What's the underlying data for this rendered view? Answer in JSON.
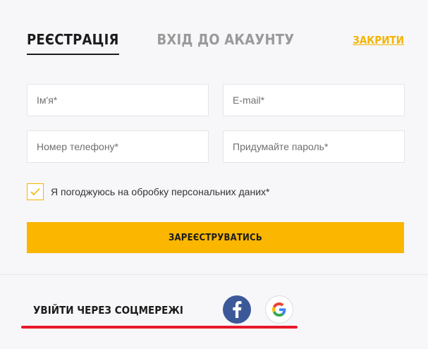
{
  "tabs": [
    {
      "label": "РЕЄСТРАЦІЯ",
      "active": true
    },
    {
      "label": "ВХІД ДО АКАУНТУ",
      "active": false
    }
  ],
  "close_label": "ЗАКРИТИ",
  "form": {
    "name_placeholder": "Ім'я*",
    "email_placeholder": "E-mail*",
    "phone_placeholder": "Номер телефону*",
    "password_placeholder": "Придумайте пароль*",
    "agree_label": "Я погоджуюсь на обробку персональних даних*",
    "agree_checked": true,
    "submit_label": "ЗАРЕЄСТРУВАТИСЬ"
  },
  "social": {
    "label": "УВІЙТИ ЧЕРЕЗ СОЦМЕРЕЖІ",
    "providers": [
      {
        "name": "facebook",
        "icon": "facebook-icon",
        "color": "#3b5998"
      },
      {
        "name": "google",
        "icon": "google-icon"
      }
    ]
  },
  "colors": {
    "accent": "#fbb600",
    "link": "#f5b400",
    "annotation": "#e8192c"
  }
}
